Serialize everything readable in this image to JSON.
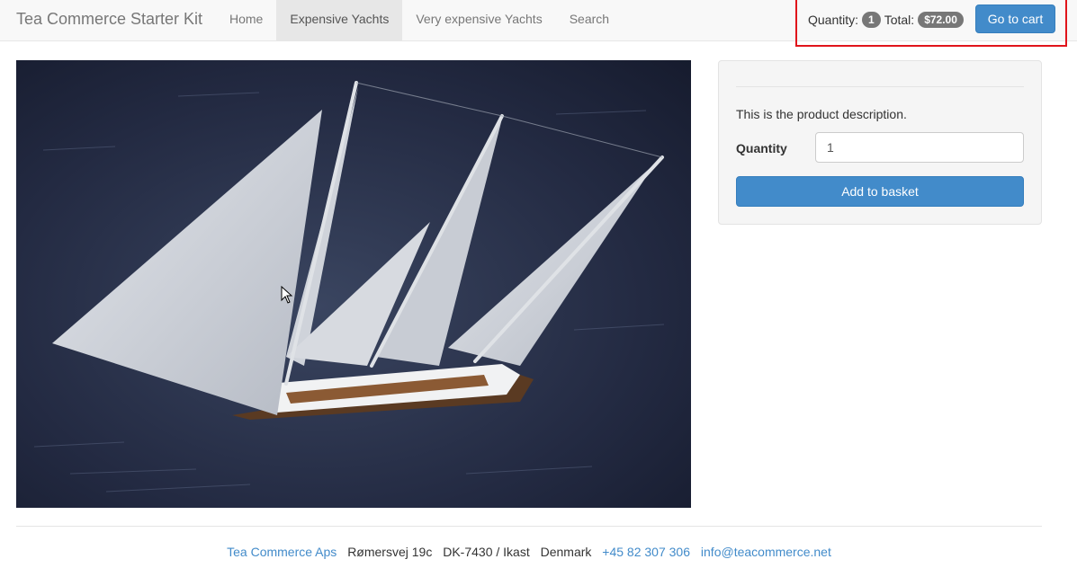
{
  "navbar": {
    "brand": "Tea Commerce Starter Kit",
    "items": [
      {
        "label": "Home",
        "active": false
      },
      {
        "label": "Expensive Yachts",
        "active": true
      },
      {
        "label": "Very expensive Yachts",
        "active": false
      },
      {
        "label": "Search",
        "active": false
      }
    ]
  },
  "cart": {
    "quantity_label": "Quantity:",
    "quantity": "1",
    "total_label": "Total:",
    "total": "$72.00",
    "button_label": "Go to cart"
  },
  "product": {
    "description": "This is the product description.",
    "quantity_label": "Quantity",
    "quantity_value": "1",
    "add_button_label": "Add to basket"
  },
  "footer": {
    "company": "Tea Commerce Aps",
    "street": "Rømersvej 19c",
    "city": "DK-7430 / Ikast",
    "country": "Denmark",
    "phone": "+45 82 307 306",
    "email": "info@teacommerce.net"
  },
  "colors": {
    "primary": "#428bca",
    "highlight_border": "#e0141b",
    "badge": "#777777"
  }
}
